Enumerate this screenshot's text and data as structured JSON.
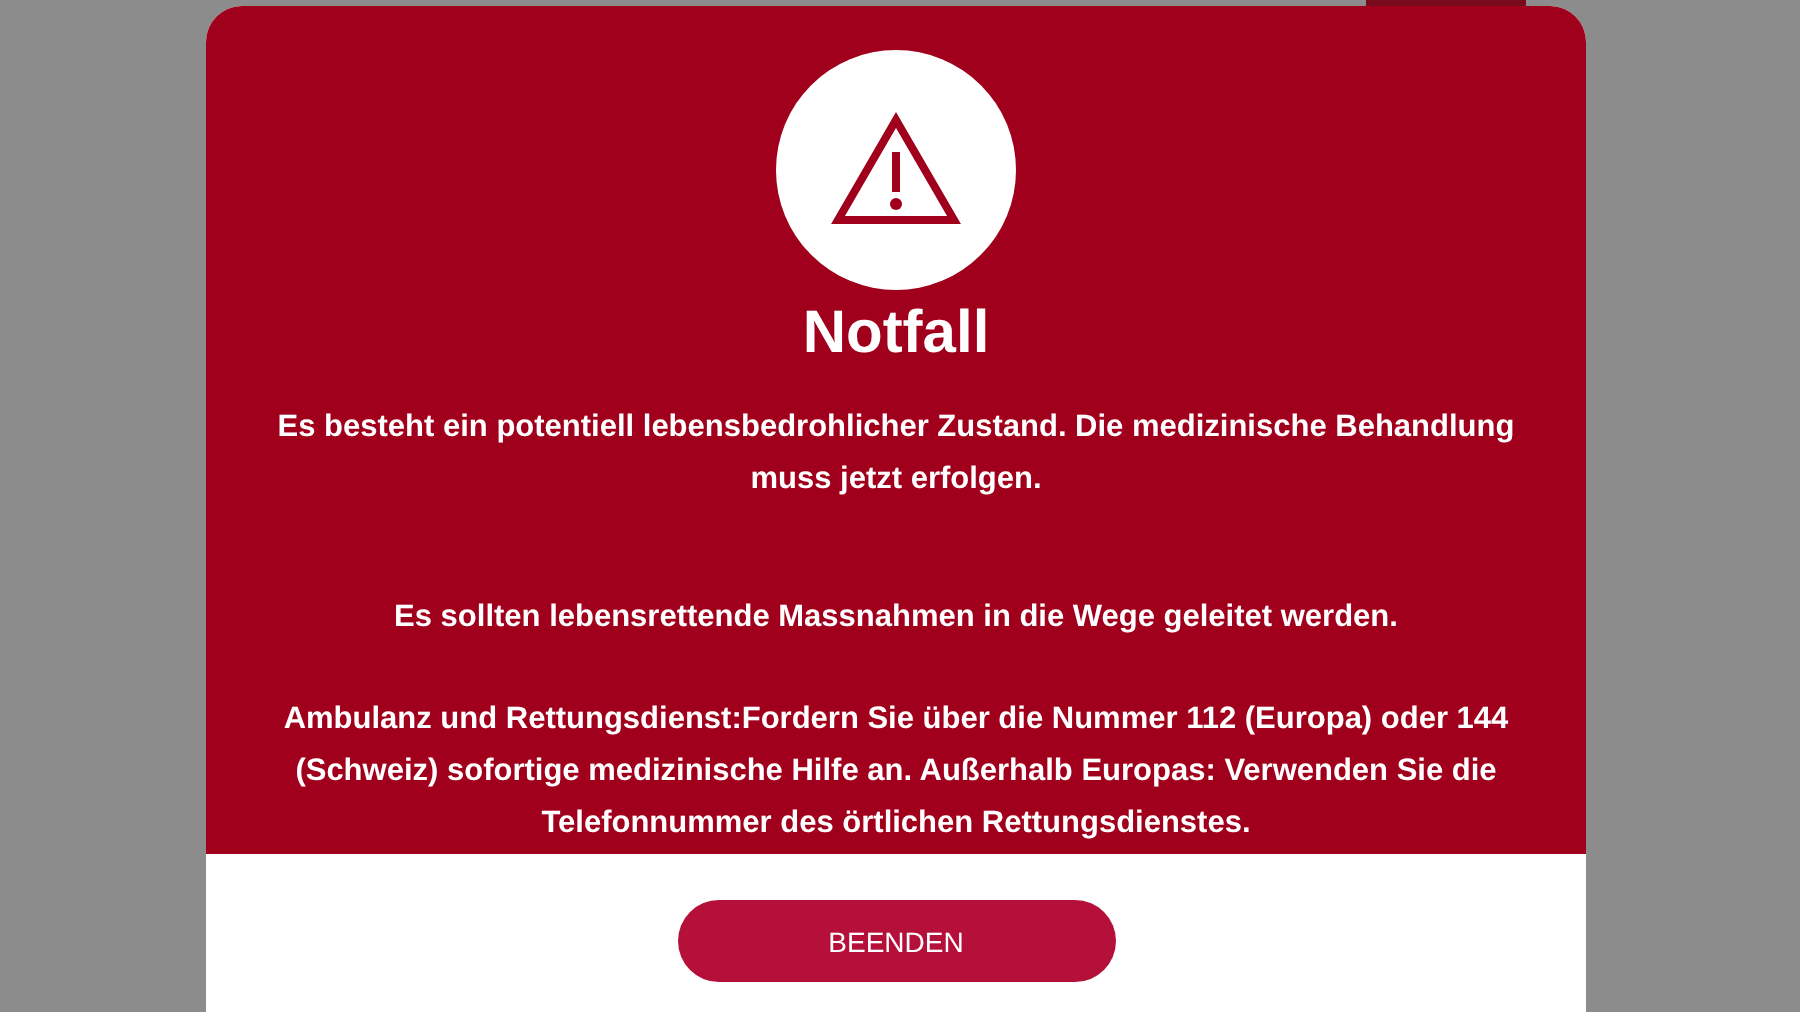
{
  "dialog": {
    "title": "Notfall",
    "paragraphs": [
      "Es besteht ein potentiell lebensbedrohlicher Zustand. Die medizinische Behandlung muss jetzt erfolgen.",
      "Es sollten lebensrettende Massnahmen in die Wege geleitet werden.",
      "Ambulanz und Rettungsdienst:Fordern Sie über die Nummer 112 (Europa) oder 144 (Schweiz) sofortige medizinische Hilfe an. Außerhalb Europas: Verwenden Sie die Telefonnummer des örtlichen Rettungsdienstes."
    ],
    "button": "BEENDEN"
  }
}
